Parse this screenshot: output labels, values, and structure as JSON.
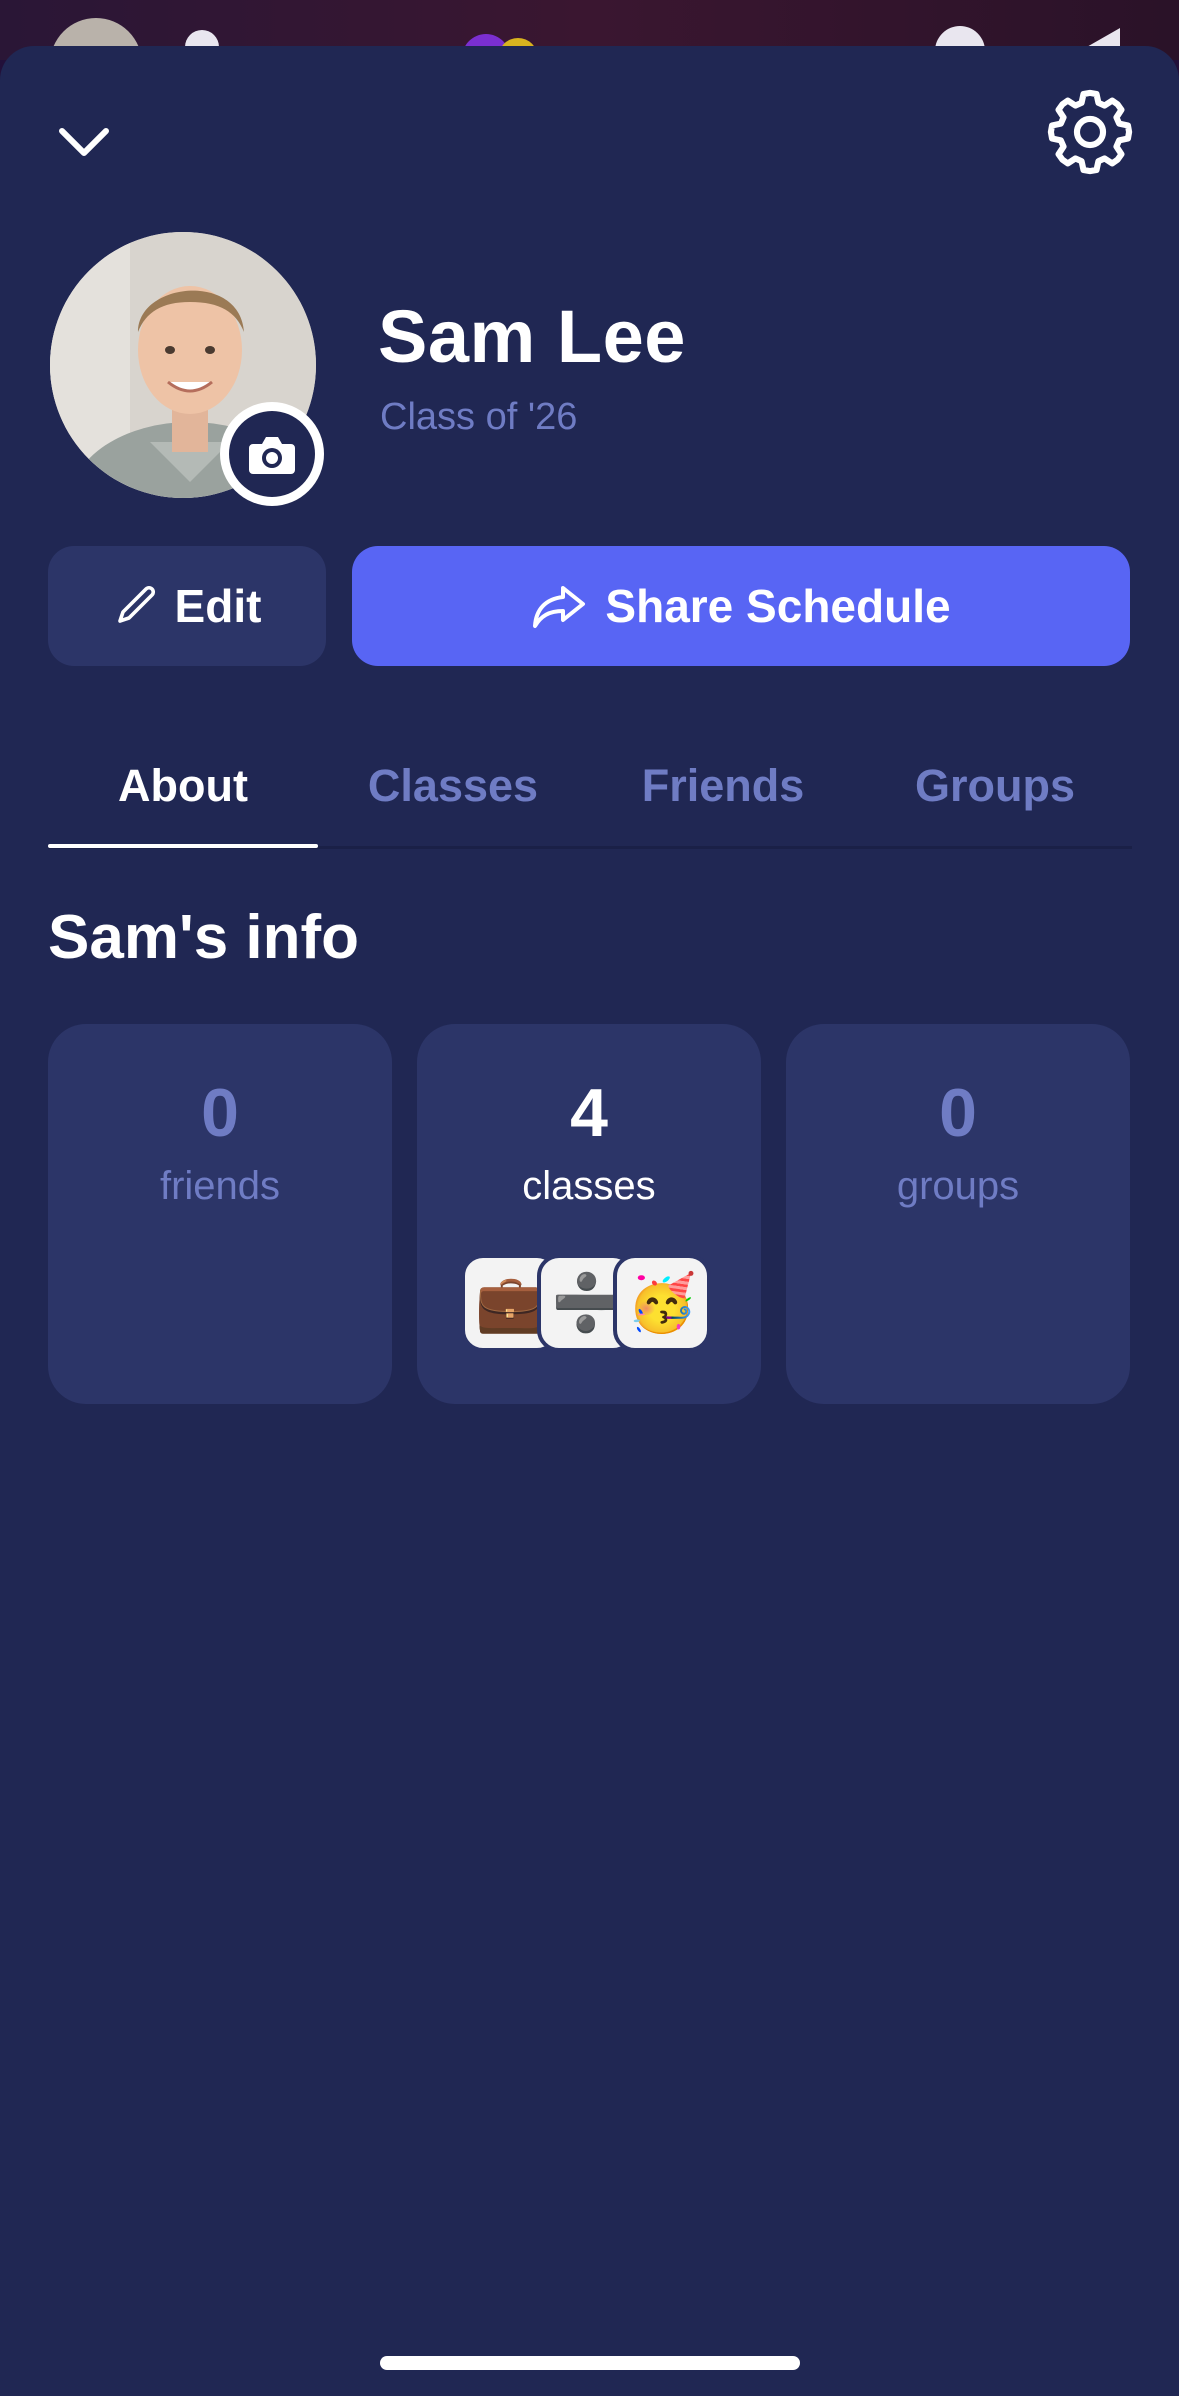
{
  "header": {
    "collapse_icon": "chevron-down-icon",
    "settings_icon": "gear-icon"
  },
  "profile": {
    "name": "Sam Lee",
    "class_year": "Class of '26",
    "avatar_icon": "avatar-photo",
    "camera_icon": "camera-icon"
  },
  "actions": {
    "edit_label": "Edit",
    "edit_icon": "pencil-icon",
    "share_label": "Share Schedule",
    "share_icon": "share-arrow-icon"
  },
  "tabs": [
    {
      "label": "About",
      "active": true
    },
    {
      "label": "Classes",
      "active": false
    },
    {
      "label": "Friends",
      "active": false
    },
    {
      "label": "Groups",
      "active": false
    }
  ],
  "info": {
    "title": "Sam's info",
    "stats": [
      {
        "number": "0",
        "label": "friends"
      },
      {
        "number": "4",
        "label": "classes",
        "emojis": [
          "💼",
          "➗",
          "🥳"
        ]
      },
      {
        "number": "0",
        "label": "groups"
      }
    ]
  },
  "colors": {
    "background": "#202753",
    "card": "#2c3568",
    "accent": "#5865f4",
    "muted_text": "#6f7cc4",
    "text": "#ffffff"
  }
}
